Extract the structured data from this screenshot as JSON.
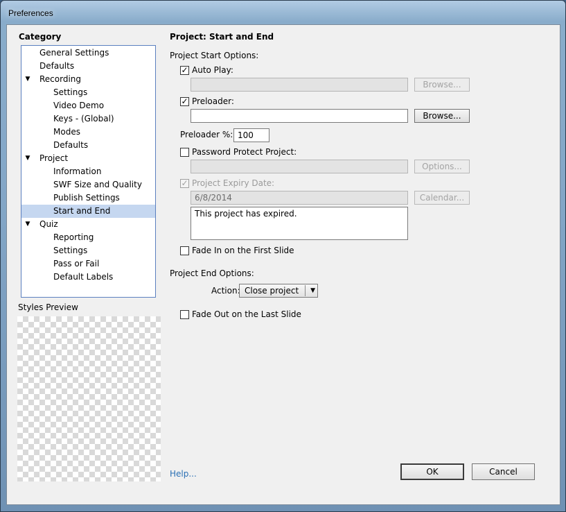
{
  "window": {
    "title": "Preferences"
  },
  "category": {
    "heading": "Category",
    "tree": [
      {
        "label": "General Settings",
        "level": 0
      },
      {
        "label": "Defaults",
        "level": 0
      },
      {
        "label": "Recording",
        "level": 0,
        "expanded": true
      },
      {
        "label": "Settings",
        "level": 1
      },
      {
        "label": "Video Demo",
        "level": 1
      },
      {
        "label": "Keys - (Global)",
        "level": 1
      },
      {
        "label": "Modes",
        "level": 1
      },
      {
        "label": "Defaults",
        "level": 1
      },
      {
        "label": "Project",
        "level": 0,
        "expanded": true
      },
      {
        "label": "Information",
        "level": 1
      },
      {
        "label": "SWF Size and Quality",
        "level": 1
      },
      {
        "label": "Publish Settings",
        "level": 1
      },
      {
        "label": "Start and End",
        "level": 1,
        "selected": true
      },
      {
        "label": "Quiz",
        "level": 0,
        "expanded": true
      },
      {
        "label": "Reporting",
        "level": 1
      },
      {
        "label": "Settings",
        "level": 1
      },
      {
        "label": "Pass or Fail",
        "level": 1
      },
      {
        "label": "Default Labels",
        "level": 1
      }
    ],
    "styles_preview_label": "Styles Preview"
  },
  "page": {
    "title": "Project: Start and End",
    "start_options_label": "Project Start Options:",
    "auto_play": {
      "label": "Auto Play:",
      "checked": true,
      "value": "",
      "browse_label": "Browse..."
    },
    "preloader": {
      "label": "Preloader:",
      "checked": true,
      "value": "",
      "browse_label": "Browse..."
    },
    "preloader_percent": {
      "label": "Preloader %:",
      "value": "100"
    },
    "password": {
      "label": "Password Protect Project:",
      "checked": false,
      "value": "",
      "options_label": "Options..."
    },
    "expiry": {
      "label": "Project Expiry Date:",
      "checked": true,
      "value": "6/8/2014",
      "calendar_label": "Calendar...",
      "message": "This project has expired."
    },
    "fade_in": {
      "label": "Fade In on the First Slide",
      "checked": false
    },
    "end_options_label": "Project End Options:",
    "action": {
      "label": "Action:",
      "value": "Close project"
    },
    "fade_out": {
      "label": "Fade Out on the Last Slide",
      "checked": false
    }
  },
  "footer": {
    "help_label": "Help...",
    "ok_label": "OK",
    "cancel_label": "Cancel"
  },
  "colors": {
    "selection": "#c5d7f0",
    "tree_border": "#5a7fbf",
    "link": "#2a6fb4"
  }
}
